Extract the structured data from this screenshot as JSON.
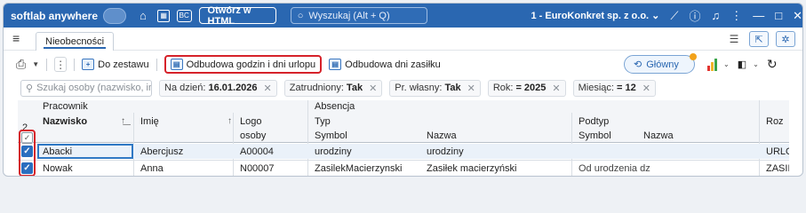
{
  "titlebar": {
    "brand": "softlab anywhere",
    "html_button": "Otwórz w HTML",
    "search_placeholder": "Wyszukaj (Alt + Q)",
    "company": "1 - EuroKonkret sp. z o.o."
  },
  "tabs": [
    {
      "label": "Nieobecności"
    }
  ],
  "toolbar": {
    "zestaw_label": "Do zestawu",
    "rebuild_hours_label": "Odbudowa godzin i dni urlopu",
    "rebuild_allowance_label": "Odbudowa dni zasiłku",
    "glowny_label": "Główny"
  },
  "filters": {
    "search_placeholder": "Szukaj osoby (nazwisko, imi...",
    "chips": [
      {
        "label": "Na dzień:",
        "value": "16.01.2026"
      },
      {
        "label": "Zatrudniony:",
        "value": "Tak"
      },
      {
        "label": "Pr. własny:",
        "value": "Tak"
      },
      {
        "label": "Rok:",
        "value": "= 2025"
      },
      {
        "label": "Miesiąc:",
        "value": "= 12"
      }
    ]
  },
  "grid": {
    "groups": {
      "pracownik": "Pracownik",
      "absencja": "Absencja"
    },
    "headers": {
      "nazwisko": "Nazwisko",
      "imie": "Imię",
      "logo": "Logo",
      "logo2": "osoby",
      "typ": "Typ",
      "symbol": "Symbol",
      "nazwa": "Nazwa",
      "podtyp": "Podtyp",
      "podsymbol": "Symbol",
      "podnazwa": "Nazwa",
      "roz": "Roz"
    },
    "selected_count": "2",
    "sort_index": "2",
    "rows": [
      {
        "nazwisko": "Abacki",
        "imie": "Abercjusz",
        "logo": "A00004",
        "symbol": "urodziny",
        "nazwa": "urodziny",
        "podtyp": "",
        "roz": "URLO"
      },
      {
        "nazwisko": "Nowak",
        "imie": "Anna",
        "logo": "N00007",
        "symbol": "ZasilekMacierzynski",
        "nazwa": "Zasiłek macierzyński",
        "podtyp": "Od urodzenia dz",
        "roz": "ZASIL"
      }
    ]
  }
}
